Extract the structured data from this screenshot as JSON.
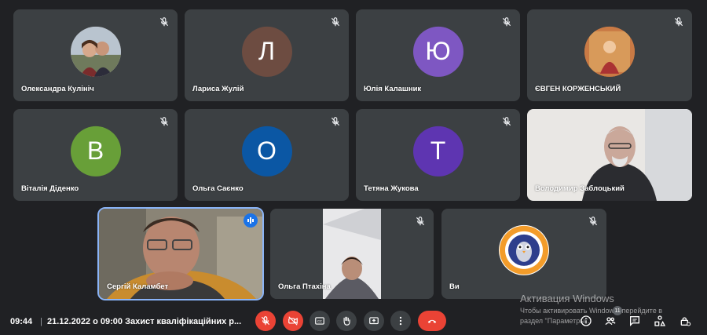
{
  "participants": [
    {
      "name": "Олександра Кулініч",
      "avatar_type": "photo",
      "muted": true
    },
    {
      "name": "Лариса Жулій",
      "avatar_type": "letter",
      "letter": "Л",
      "color": "#6d4c41",
      "muted": true
    },
    {
      "name": "Юлія Калашник",
      "avatar_type": "letter",
      "letter": "Ю",
      "color": "#7e57c2",
      "muted": true
    },
    {
      "name": "ЄВГЕН КОРЖЕНСЬКИЙ",
      "avatar_type": "photo",
      "muted": true
    },
    {
      "name": "Віталія Діденко",
      "avatar_type": "letter",
      "letter": "В",
      "color": "#689f38",
      "muted": true
    },
    {
      "name": "Ольга Саєнко",
      "avatar_type": "letter",
      "letter": "О",
      "color": "#0b57a4",
      "muted": true
    },
    {
      "name": "Тетяна Жукова",
      "avatar_type": "letter",
      "letter": "Т",
      "color": "#5e35b1",
      "muted": true
    },
    {
      "name": "Володимир Заблоцький",
      "avatar_type": "video",
      "muted": false
    },
    {
      "name": "Сергій Каламбет",
      "avatar_type": "video",
      "speaking": true,
      "muted": false
    },
    {
      "name": "Ольга Птахіна",
      "avatar_type": "video",
      "muted": true
    },
    {
      "name": "Ви",
      "avatar_type": "logo",
      "muted": true
    }
  ],
  "bottom_bar": {
    "time": "09:44",
    "separator": "|",
    "meeting_title": "21.12.2022 о 09:00 Захист кваліфікаційних р...",
    "controls": [
      "mic-off-icon",
      "camera-off-icon",
      "captions-icon",
      "raise-hand-icon",
      "present-icon",
      "more-icon",
      "end-call-icon"
    ],
    "right_icons": [
      "info-icon",
      "people-icon",
      "chat-icon",
      "activities-icon",
      "host-controls-icon"
    ],
    "people_count": "11"
  },
  "watermark": {
    "line1": "Активация Windows",
    "line2": "Чтобы активировать Windows, перейдите в",
    "line3": "раздел \"Параметры\"."
  },
  "colors": {
    "background": "#202124",
    "tile": "#3c4043",
    "end_call": "#ea4335",
    "speaking": "#1a73e8"
  }
}
